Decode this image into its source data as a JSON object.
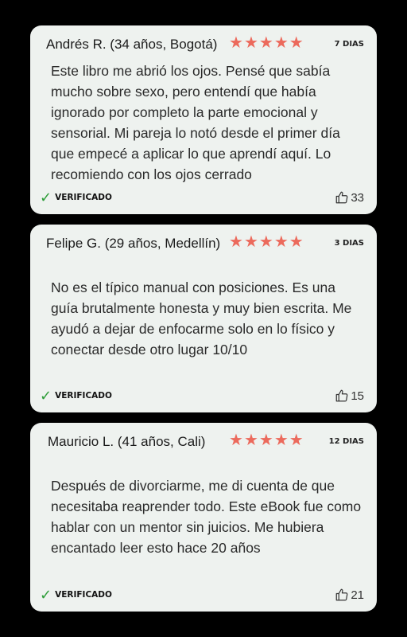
{
  "reviews": [
    {
      "author": "Andrés R. (34 años, Bogotá)",
      "stars": 5,
      "days": "7 DIAS",
      "text": "Este libro me abrió los ojos. Pensé que sabía mucho sobre sexo, pero entendí que había ignorado por completo la parte emocional y sensorial. Mi pareja lo notó desde el primer día que empecé a aplicar lo que aprendí aquí. Lo recomiendo con los ojos cerrado",
      "verified": "VERIFICADO",
      "likes": "33"
    },
    {
      "author": "Felipe G. (29 años, Medellín)",
      "stars": 5,
      "days": "3 DIAS",
      "text": "No es el típico manual con posiciones. Es una guía brutalmente honesta y muy bien escrita. Me ayudó a dejar de enfocarme solo en lo físico y conectar desde otro lugar 10/10",
      "verified": "VERIFICADO",
      "likes": "15"
    },
    {
      "author": "Mauricio L. (41 años, Cali)",
      "stars": 5,
      "days": "12 DIAS",
      "text": "Después de divorciarme, me di cuenta de que necesitaba reaprender todo. Este eBook fue como hablar con un mentor sin juicios. Me hubiera encantado leer esto hace 20 años",
      "verified": "VERIFICADO",
      "likes": "21"
    }
  ],
  "colors": {
    "star": "#ec6a5c",
    "check": "#2f9e3a",
    "card": "#eef2ef",
    "background": "#000000"
  },
  "icons": {
    "star": "star-icon",
    "check": "checkmark-icon",
    "like": "thumbs-up-icon"
  }
}
